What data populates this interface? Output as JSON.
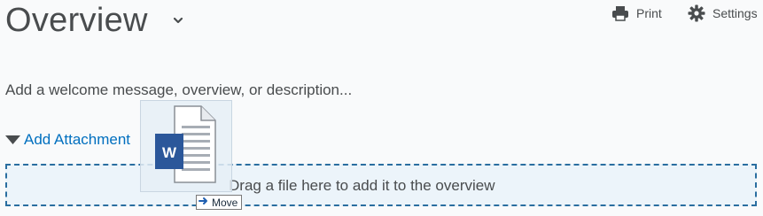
{
  "header": {
    "title": "Overview",
    "print_label": "Print",
    "settings_label": "Settings"
  },
  "content": {
    "welcome_placeholder": "Add a welcome message, overview, or description..."
  },
  "attachments": {
    "toggle_label": "Add Attachment",
    "dropzone_text": "Drag a file here to add it to the overview"
  },
  "drag": {
    "file_type_icon": "word-document-icon",
    "badge_label": "Move"
  },
  "colors": {
    "link": "#006fbf",
    "dropzone_border": "#2a6ea0",
    "word_blue": "#2b579a"
  }
}
